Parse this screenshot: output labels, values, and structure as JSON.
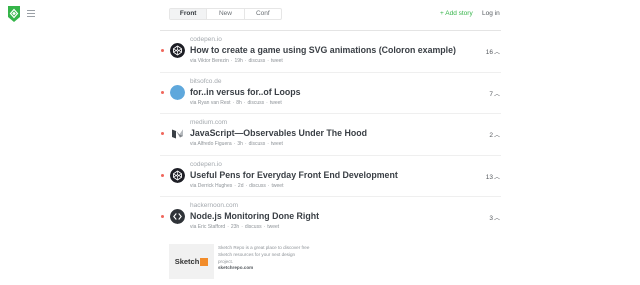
{
  "header": {
    "tabs": [
      {
        "label": "Front",
        "active": true
      },
      {
        "label": "New",
        "active": false
      },
      {
        "label": "Conf",
        "active": false
      }
    ],
    "add_story": "+ Add story",
    "login": "Log in",
    "logo_icon": "diamond-code-icon",
    "menu_icon": "hamburger-icon",
    "brand_color": "#35b449",
    "accent_dot_color": "#f0675c"
  },
  "stories": [
    {
      "domain": "codepen.io",
      "title": "How to create a game using SVG animations (Coloron example)",
      "author": "via Viktor Berezin",
      "age": "19h",
      "discuss": "discuss",
      "tweet": "tweet",
      "score": "16",
      "avatar": "codepen"
    },
    {
      "domain": "bitsofco.de",
      "title": "for..in versus for..of Loops",
      "author": "via Ryan van Rest",
      "age": "8h",
      "discuss": "discuss",
      "tweet": "tweet",
      "score": "7",
      "avatar": "bitsofcode"
    },
    {
      "domain": "medium.com",
      "title": "JavaScript—Observables Under The Hood",
      "author": "via Alfredo Figuera",
      "age": "3h",
      "discuss": "discuss",
      "tweet": "tweet",
      "score": "2",
      "avatar": "medium"
    },
    {
      "domain": "codepen.io",
      "title": "Useful Pens for Everyday Front End Development",
      "author": "via Derrick Hughes",
      "age": "2d",
      "discuss": "discuss",
      "tweet": "tweet",
      "score": "13",
      "avatar": "codepen"
    },
    {
      "domain": "hackernoon.com",
      "title": "Node.js Monitoring Done Right",
      "author": "via Eric Stafford",
      "age": "23h",
      "discuss": "discuss",
      "tweet": "tweet",
      "score": "3",
      "avatar": "hackernoon"
    }
  ],
  "sponsor": {
    "image_text": "Sketch",
    "text": "Sketch Repo is a great place to discover free Sketch resources for your next design project.",
    "link": "sketchrepo.com"
  }
}
